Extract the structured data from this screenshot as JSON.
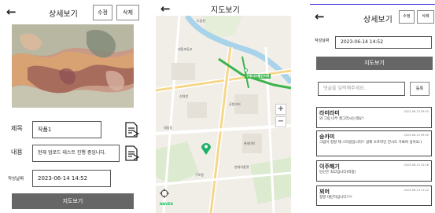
{
  "detail": {
    "back_icon": "←",
    "title": "상세보기",
    "edit_label": "수정",
    "delete_label": "삭제",
    "title_label": "제목",
    "title_value": "작품1",
    "content_label": "내용",
    "content_value": "현재 업로드 테스트 진행 중입니다.",
    "date_label": "작성날짜",
    "date_value": "2023-06-14 14:52",
    "map_button_label": "지도보기"
  },
  "map": {
    "back_icon": "←",
    "title": "지도보기",
    "highlight_label": "구로디지털단지역",
    "place_labels": [
      "대림초등교",
      "구로디지털단지역",
      "공원거리",
      "신대방",
      "롯데마트",
      "대림동",
      "현대아울렛",
      "구로동",
      "도림천",
      "NAVER"
    ],
    "zoom_in": "+",
    "zoom_out": "−",
    "locate_icon": "crosshair-icon"
  },
  "comments_screen": {
    "back_icon": "←",
    "title": "상세보기",
    "edit_label": "수정",
    "delete_label": "삭제",
    "date_label": "작성날짜",
    "date_value": "2023-06-14 14:52",
    "map_button_label": "지도보기",
    "comment_placeholder": "댓글을 입력해주세요.",
    "submit_label": "등록",
    "comments": [
      {
        "name": "라미라미",
        "date": "2023-06-13 09:53",
        "text": "와 그림 너무 잘그리시는데요?"
      },
      {
        "name": "승카미",
        "date": "2023-06-13 09:55",
        "text": "그림이 정말 제 스타일입니다!! 실제 오프라인 전시도 가봐야 싶어요:)"
      },
      {
        "name": "이주해기",
        "date": "2023-06-13 10:18",
        "text": "당신은 최고입니다(따봉)"
      },
      {
        "name": "꾀머",
        "date": "2023-06-13 11:12",
        "text": "정말 대단하십니다!!!!"
      }
    ]
  }
}
